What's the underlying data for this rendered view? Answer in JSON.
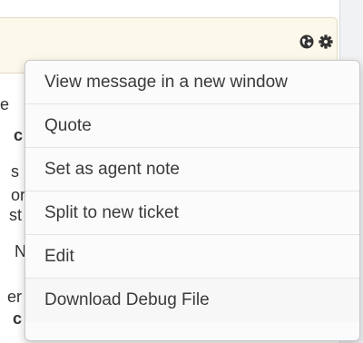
{
  "background": {
    "fragments": [
      "e",
      "c",
      "s",
      "or",
      "st",
      "N",
      "er",
      "c"
    ]
  },
  "header": {
    "globe_icon": "globe-icon",
    "gear_icon": "gear-icon"
  },
  "context_menu": {
    "items": [
      {
        "label": "View message in a new window"
      },
      {
        "label": "Quote"
      },
      {
        "label": "Set as agent note"
      },
      {
        "label": "Split to new ticket"
      },
      {
        "label": "Edit"
      },
      {
        "label": "Download Debug File"
      }
    ]
  },
  "colors": {
    "header_bg": "#fcf8ea",
    "menu_bg": "#fbfbfb",
    "text": "#3a3a3a"
  }
}
